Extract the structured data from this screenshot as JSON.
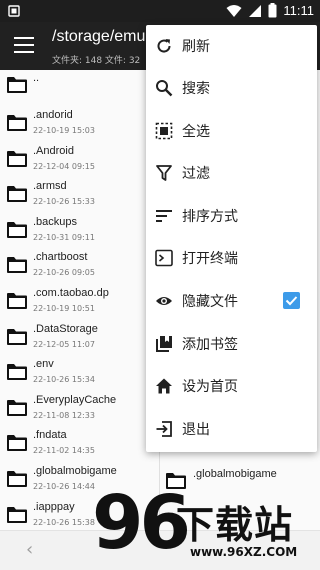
{
  "status_bar": {
    "time": "11:11",
    "colors": {
      "bg": "#1e1e1e"
    }
  },
  "app_bar": {
    "title": "/storage/emu",
    "subtitle": "文件夹: 148  文件: 32"
  },
  "files": [
    {
      "name": "..",
      "date": ""
    },
    {
      "name": ".andorid",
      "date": "22-10-19 15:03"
    },
    {
      "name": ".Android",
      "date": "22-12-04 09:15"
    },
    {
      "name": ".armsd",
      "date": "22-10-26 15:33"
    },
    {
      "name": ".backups",
      "date": "22-10-31 09:11"
    },
    {
      "name": ".chartboost",
      "date": "22-10-26 09:05"
    },
    {
      "name": ".com.taobao.dp",
      "date": "22-10-19 10:51"
    },
    {
      "name": ".DataStorage",
      "date": "22-12-05 11:07"
    },
    {
      "name": ".env",
      "date": "22-10-26 15:34"
    },
    {
      "name": ".EveryplayCache",
      "date": "22-11-08 12:33"
    },
    {
      "name": ".fndata",
      "date": "22-11-02 14:35"
    },
    {
      "name": ".globalmobigame",
      "date": "22-10-26 14:44"
    },
    {
      "name": ".iapppay",
      "date": "22-10-26 15:38"
    }
  ],
  "right_pane": {
    "date_partial": "22-11-02 14:35",
    "folder_name": ".globalmobigame"
  },
  "menu": {
    "items": [
      {
        "label": "刷新",
        "icon": "refresh-icon"
      },
      {
        "label": "搜索",
        "icon": "search-icon"
      },
      {
        "label": "全选",
        "icon": "select-all-icon"
      },
      {
        "label": "过滤",
        "icon": "filter-icon"
      },
      {
        "label": "排序方式",
        "icon": "sort-icon"
      },
      {
        "label": "打开终端",
        "icon": "terminal-icon"
      },
      {
        "label": "隐藏文件",
        "icon": "eye-icon",
        "checked": true
      },
      {
        "label": "添加书签",
        "icon": "bookmark-icon"
      },
      {
        "label": "设为首页",
        "icon": "home-icon"
      },
      {
        "label": "退出",
        "icon": "exit-icon"
      }
    ]
  },
  "watermark": {
    "number": "96",
    "text": "下载站",
    "url": "www.96XZ.COM"
  },
  "colors": {
    "accent": "#3d9be9",
    "app_bar": "#212121"
  }
}
